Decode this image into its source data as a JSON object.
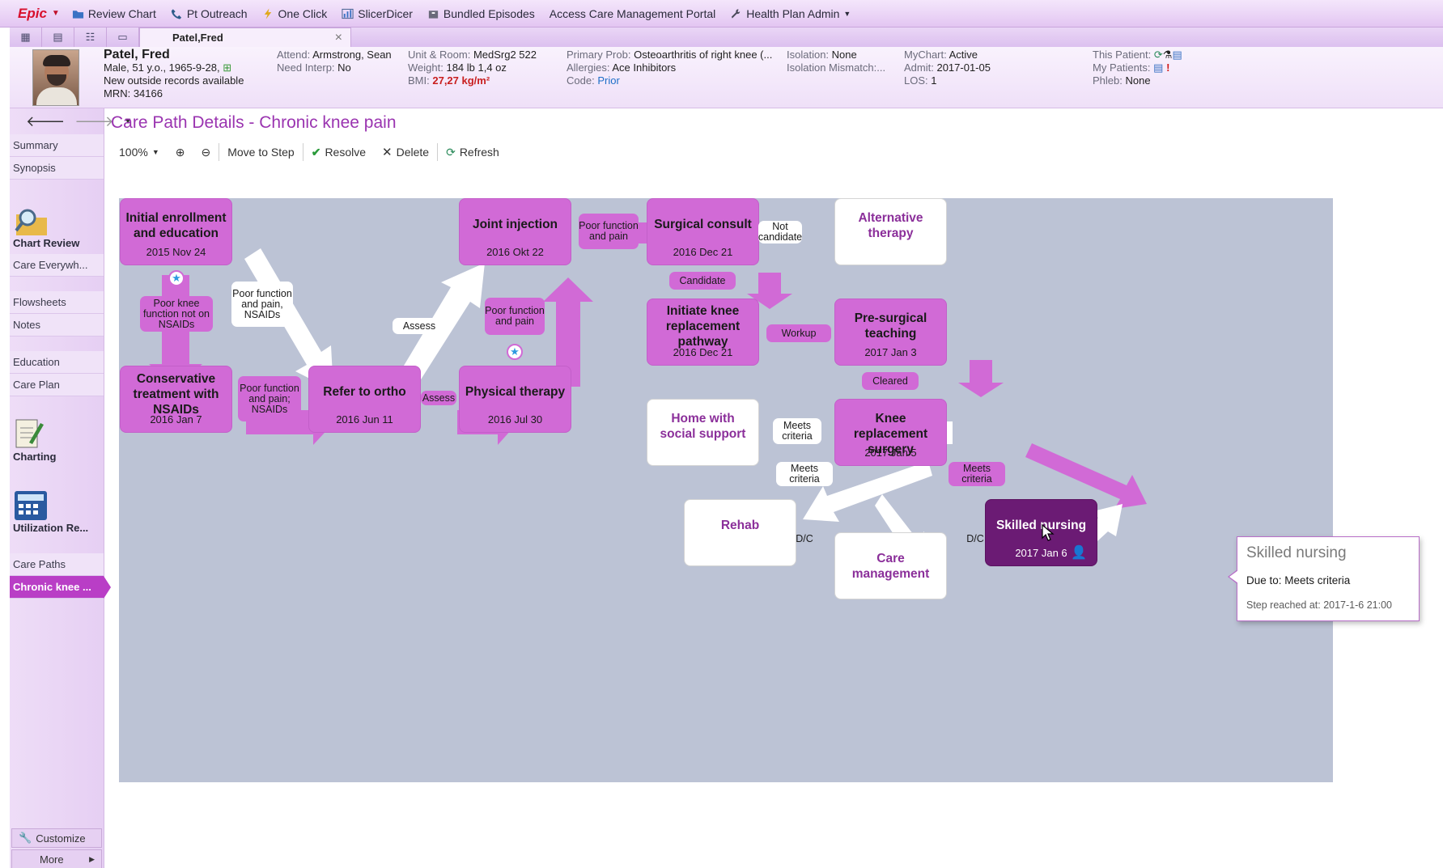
{
  "toolbar": {
    "logo": "Epic",
    "items": [
      "Review Chart",
      "Pt Outreach",
      "One Click",
      "SlicerDicer",
      "Bundled Episodes",
      "Access Care Management Portal",
      "Health Plan Admin"
    ]
  },
  "tab": {
    "patient": "Patel,Fred"
  },
  "patient": {
    "name": "Patel, Fred",
    "demo": "Male, 51 y.o., 1965-9-28,",
    "outside": "New outside records available",
    "mrn": "MRN: 34166",
    "attend_label": "Attend:",
    "attend": "Armstrong, Sean",
    "interp_label": "Need Interp:",
    "interp": "No",
    "unit_label": "Unit & Room:",
    "unit": "MedSrg2 522",
    "weight_label": "Weight:",
    "weight": "184 lb 1,4 oz",
    "bmi_label": "BMI:",
    "bmi": "27,27 kg/m²",
    "prob_label": "Primary Prob:",
    "prob": "Osteoarthritis of right knee (...",
    "allergies_label": "Allergies:",
    "allergies": "Ace Inhibitors",
    "code_label": "Code:",
    "code": "Prior",
    "isolation_label": "Isolation:",
    "isolation": "None",
    "isomismatch_label": "Isolation Mismatch:...",
    "mychart_label": "MyChart:",
    "mychart": "Active",
    "admit_label": "Admit:",
    "admit": "2017-01-05",
    "los_label": "LOS:",
    "los": "1",
    "thispatient_label": "This Patient:",
    "mypatients_label": "My Patients:",
    "phleb_label": "Phleb:",
    "phleb": "None"
  },
  "nav": {
    "summary": "Summary",
    "synopsis": "Synopsis",
    "chart_review": "Chart Review",
    "care_everywhere": "Care Everywh...",
    "flowsheets": "Flowsheets",
    "notes": "Notes",
    "education": "Education",
    "care_plan": "Care Plan",
    "charting": "Charting",
    "utilization": "Utilization Re...",
    "care_paths": "Care Paths",
    "chronic": "Chronic knee ...",
    "customize": "Customize",
    "more": "More"
  },
  "page": {
    "title": "Care Path Details - Chronic knee pain"
  },
  "actions": {
    "zoom": "100%",
    "move": "Move to Step",
    "resolve": "Resolve",
    "delete": "Delete",
    "refresh": "Refresh"
  },
  "nodes": {
    "initial": {
      "title": "Initial enrollment and education",
      "date": "2015 Nov 24"
    },
    "conservative": {
      "title": "Conservative treatment with NSAIDs",
      "date": "2016 Jan 7"
    },
    "refer": {
      "title": "Refer to ortho",
      "date": "2016 Jun 11"
    },
    "joint": {
      "title": "Joint injection",
      "date": "2016 Okt 22"
    },
    "pt": {
      "title": "Physical therapy",
      "date": "2016 Jul 30"
    },
    "surgical": {
      "title": "Surgical consult",
      "date": "2016 Dec 21"
    },
    "alternative": {
      "title": "Alternative therapy"
    },
    "initiate": {
      "title": "Initiate knee replacement pathway",
      "date": "2016 Dec 21"
    },
    "presurgical": {
      "title": "Pre-surgical teaching",
      "date": "2017 Jan 3"
    },
    "home": {
      "title": "Home with social support"
    },
    "knee": {
      "title": "Knee replacement surgery",
      "date": "2017 Jan 5"
    },
    "rehab": {
      "title": "Rehab"
    },
    "caremgmt": {
      "title": "Care management"
    },
    "skilled": {
      "title": "Skilled nursing",
      "date": "2017 Jan 6"
    }
  },
  "edges": {
    "poor_knee": "Poor knee function not on NSAIDs",
    "poor_fn_nsaids": "Poor function and pain, NSAIDs",
    "poor_fn_nsaids2": "Poor function and pain; NSAIDs",
    "assess1": "Assess",
    "assess2": "Assess",
    "poor_fn_pain_pt": "Poor function and pain",
    "poor_fn_pain_ji": "Poor function and pain",
    "not_candidate": "Not candidate",
    "candidate": "Candidate",
    "workup": "Workup",
    "cleared": "Cleared",
    "meets1": "Meets criteria",
    "meets2": "Meets criteria",
    "meets3": "Meets criteria",
    "dc1": "D/C",
    "dc2": "D/C"
  },
  "tooltip": {
    "title": "Skilled nursing",
    "due": "Due to: Meets criteria",
    "reached": "Step reached at: 2017-1-6 21:00"
  }
}
